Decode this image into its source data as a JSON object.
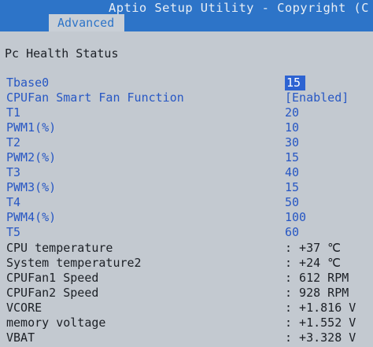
{
  "title_bar": {
    "title": "Aptio Setup Utility - Copyright (C",
    "tab_label": "Advanced"
  },
  "section_title": "Pc Health Status",
  "settings": [
    {
      "label": "Tbase0",
      "value": "15"
    },
    {
      "label": "CPUFan Smart Fan Function",
      "value": "[Enabled]"
    },
    {
      "label": "T1",
      "value": "20"
    },
    {
      "label": "PWM1(%)",
      "value": "10"
    },
    {
      "label": "T2",
      "value": "30"
    },
    {
      "label": "PWM2(%)",
      "value": "15"
    },
    {
      "label": "T3",
      "value": "40"
    },
    {
      "label": "PWM3(%)",
      "value": "15"
    },
    {
      "label": "T4",
      "value": "50"
    },
    {
      "label": "PWM4(%)",
      "value": "100"
    },
    {
      "label": "T5",
      "value": "60"
    }
  ],
  "readings": [
    {
      "label": "CPU temperature",
      "value": ": +37 ℃"
    },
    {
      "label": "System temperature2",
      "value": ": +24 ℃"
    },
    {
      "label": "CPUFan1 Speed",
      "value": ": 612 RPM"
    },
    {
      "label": "CPUFan2 Speed",
      "value": ": 928 RPM"
    },
    {
      "label": "VCORE",
      "value": ": +1.816 V"
    },
    {
      "label": "memory voltage",
      "value": ": +1.552 V"
    },
    {
      "label": "VBAT",
      "value": ": +3.328 V"
    }
  ],
  "colors": {
    "title_bar": "#2d74c8",
    "panel": "#c3c9d0",
    "setting_text": "#2757c4",
    "reading_text": "#1c2026",
    "selection": "#2d63d2"
  }
}
